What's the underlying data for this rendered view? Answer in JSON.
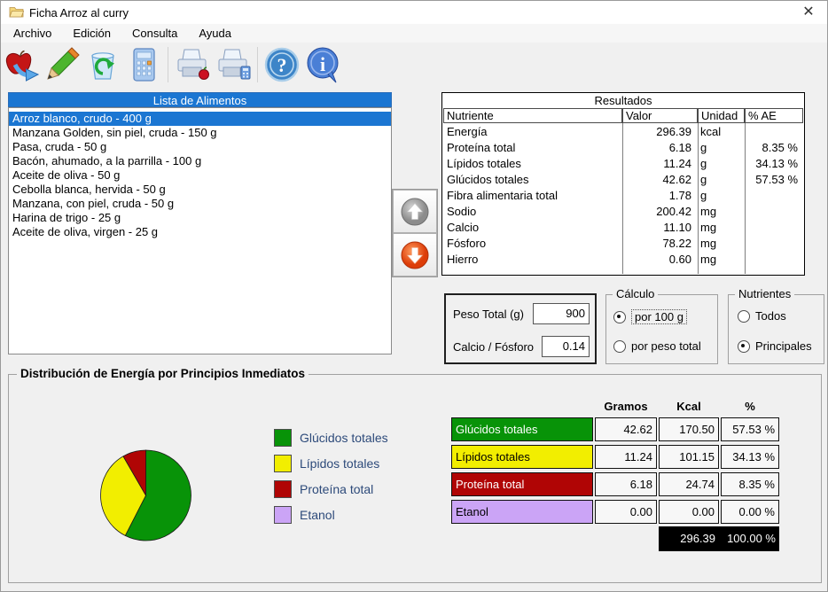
{
  "window": {
    "title": "Ficha Arroz al curry"
  },
  "icons": {
    "close": "✕"
  },
  "menu": {
    "items": [
      "Archivo",
      "Edición",
      "Consulta",
      "Ayuda"
    ]
  },
  "toolbar": {
    "buttons": [
      "add-food",
      "edit-food",
      "clear-list",
      "calculate",
      "print-food",
      "print-calculation",
      "help",
      "info"
    ]
  },
  "food_list": {
    "header": "Lista de Alimentos",
    "selected_index": 0,
    "selected_color": "#1b76d2",
    "items": [
      "Arroz blanco, crudo - 400 g",
      "Manzana Golden, sin piel, cruda - 150 g",
      "Pasa, cruda - 50 g",
      "Bacón, ahumado, a la parrilla - 100 g",
      "Aceite de oliva - 50 g",
      "Cebolla blanca, hervida - 50 g",
      "Manzana, con piel, cruda - 50 g",
      "Harina de trigo - 25 g",
      "Aceite de oliva, virgen - 25 g"
    ]
  },
  "results": {
    "title": "Resultados",
    "columns": {
      "nutrient": "Nutriente",
      "value": "Valor",
      "unit": "Unidad",
      "pae": "% AE"
    },
    "rows": [
      {
        "nutrient": "Energía",
        "value": "296.39",
        "unit": "kcal",
        "pae": ""
      },
      {
        "nutrient": "Proteína total",
        "value": "6.18",
        "unit": "g",
        "pae": "8.35 %"
      },
      {
        "nutrient": "Lípidos totales",
        "value": "11.24",
        "unit": "g",
        "pae": "34.13 %"
      },
      {
        "nutrient": "Glúcidos totales",
        "value": "42.62",
        "unit": "g",
        "pae": "57.53 %"
      },
      {
        "nutrient": "Fibra alimentaria total",
        "value": "1.78",
        "unit": "g",
        "pae": ""
      },
      {
        "nutrient": "Sodio",
        "value": "200.42",
        "unit": "mg",
        "pae": ""
      },
      {
        "nutrient": "Calcio",
        "value": "11.10",
        "unit": "mg",
        "pae": ""
      },
      {
        "nutrient": "Fósforo",
        "value": "78.22",
        "unit": "mg",
        "pae": ""
      },
      {
        "nutrient": "Hierro",
        "value": "0.60",
        "unit": "mg",
        "pae": ""
      }
    ]
  },
  "summary": {
    "peso_label": "Peso Total (g)",
    "peso_value": "900",
    "calcio_fosforo_label": "Calcio / Fósforo",
    "calcio_fosforo_value": "0.14"
  },
  "calculo": {
    "title": "Cálculo",
    "option1": {
      "label": "por 100 g",
      "selected": true
    },
    "option2": {
      "label": "por peso total",
      "selected": false
    }
  },
  "nutrientes": {
    "title": "Nutrientes",
    "option1": {
      "label": "Todos",
      "selected": false
    },
    "option2": {
      "label": "Principales",
      "selected": true
    }
  },
  "distribution": {
    "title": "Distribución de Energía por Principios Inmediatos",
    "chart_data": {
      "type": "pie",
      "slices": [
        {
          "label": "Glúcidos totales",
          "value": 57.53,
          "color": "#089308"
        },
        {
          "label": "Lípidos totales",
          "value": 34.13,
          "color": "#f2ee00"
        },
        {
          "label": "Proteína total",
          "value": 8.35,
          "color": "#b00505"
        },
        {
          "label": "Etanol",
          "value": 0.0,
          "color": "#cba4f6"
        }
      ],
      "legend_position": "right",
      "start_angle_deg": 0,
      "direction": "clockwise"
    },
    "table": {
      "columns": [
        "Gramos",
        "Kcal",
        "%"
      ],
      "rows": [
        {
          "label": "Glúcidos totales",
          "color": "#089308",
          "text_color": "#ffffff",
          "gramos": "42.62",
          "kcal": "170.50",
          "pct": "57.53 %"
        },
        {
          "label": "Lípidos totales",
          "color": "#f2ee00",
          "text_color": "#000000",
          "gramos": "11.24",
          "kcal": "101.15",
          "pct": "34.13 %"
        },
        {
          "label": "Proteína total",
          "color": "#b00505",
          "text_color": "#ffffff",
          "gramos": "6.18",
          "kcal": "24.74",
          "pct": "8.35 %"
        },
        {
          "label": "Etanol",
          "color": "#cba4f6",
          "text_color": "#000000",
          "gramos": "0.00",
          "kcal": "0.00",
          "pct": "0.00 %"
        }
      ],
      "total": {
        "kcal": "296.39",
        "pct": "100.00 %"
      }
    }
  }
}
